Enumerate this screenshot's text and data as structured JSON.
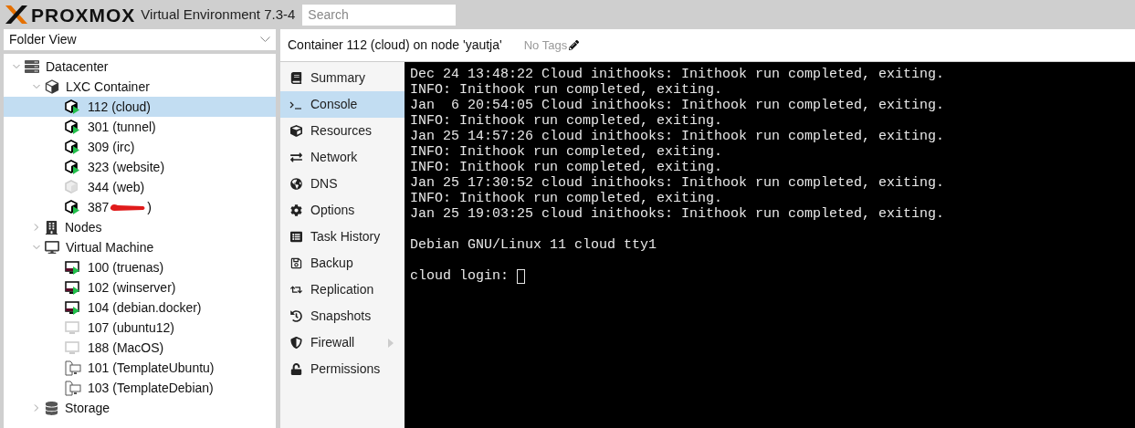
{
  "header": {
    "logo": "PROXMOX",
    "product": "Virtual Environment 7.3-4",
    "search": {
      "placeholder": "Search"
    }
  },
  "view_selector": {
    "value": "Folder View"
  },
  "tree": [
    {
      "kind": "datacenter",
      "label": "Datacenter",
      "expanded": true,
      "selected": false,
      "children": [
        {
          "kind": "folder-ct",
          "label": "LXC Container",
          "expanded": true,
          "selected": false,
          "children": [
            {
              "kind": "ct",
              "label": "112 (cloud)",
              "running": true,
              "selected": true
            },
            {
              "kind": "ct",
              "label": "301 (tunnel)",
              "running": true,
              "selected": false
            },
            {
              "kind": "ct",
              "label": "309 (irc)",
              "running": true,
              "selected": false
            },
            {
              "kind": "ct",
              "label": "323 (website)",
              "running": true,
              "selected": false
            },
            {
              "kind": "ct",
              "label": "344 (web)",
              "running": false,
              "selected": false
            },
            {
              "kind": "ct",
              "label": "387",
              "running": true,
              "selected": false,
              "redacted": true,
              "tail": ")"
            }
          ]
        },
        {
          "kind": "nodes",
          "label": "Nodes",
          "expanded": false,
          "selected": false
        },
        {
          "kind": "folder-vm",
          "label": "Virtual Machine",
          "expanded": true,
          "selected": false,
          "children": [
            {
              "kind": "vm",
              "label": "100 (truenas)",
              "running": true,
              "selected": false
            },
            {
              "kind": "vm",
              "label": "102 (winserver)",
              "running": true,
              "selected": false
            },
            {
              "kind": "vm",
              "label": "104 (debian.docker)",
              "running": true,
              "selected": false
            },
            {
              "kind": "vm",
              "label": "107 (ubuntu12)",
              "running": false,
              "selected": false
            },
            {
              "kind": "vm",
              "label": "188 (MacOS)",
              "running": false,
              "selected": false
            },
            {
              "kind": "template",
              "label": "101 (TemplateUbuntu)",
              "selected": false
            },
            {
              "kind": "template",
              "label": "103 (TemplateDebian)",
              "selected": false
            }
          ]
        },
        {
          "kind": "storage",
          "label": "Storage",
          "expanded": false,
          "selected": false
        }
      ]
    }
  ],
  "content_header": {
    "title": "Container 112 (cloud) on node 'yautja'",
    "tags": "No Tags"
  },
  "menu": [
    {
      "kind": "summary",
      "label": "Summary",
      "selected": false
    },
    {
      "kind": "console",
      "label": "Console",
      "selected": true
    },
    {
      "kind": "resources",
      "label": "Resources",
      "selected": false
    },
    {
      "kind": "network",
      "label": "Network",
      "selected": false
    },
    {
      "kind": "dns",
      "label": "DNS",
      "selected": false
    },
    {
      "kind": "options",
      "label": "Options",
      "selected": false
    },
    {
      "kind": "tasks",
      "label": "Task History",
      "selected": false
    },
    {
      "kind": "backup",
      "label": "Backup",
      "selected": false
    },
    {
      "kind": "replication",
      "label": "Replication",
      "selected": false
    },
    {
      "kind": "snapshots",
      "label": "Snapshots",
      "selected": false
    },
    {
      "kind": "firewall",
      "label": "Firewall",
      "selected": false,
      "submenu": true
    },
    {
      "kind": "permissions",
      "label": "Permissions",
      "selected": false
    }
  ],
  "console": {
    "blocks": [
      [
        "Dec 24 13:48:22 Cloud inithooks: Inithook run completed, exiting.",
        "INFO: Inithook run completed, exiting.",
        "Jan  6 20:54:05 Cloud inithooks: Inithook run completed, exiting.",
        "INFO: Inithook run completed, exiting.",
        "Jan 25 14:57:26 cloud inithooks: Inithook run completed, exiting.",
        "INFO: Inithook run completed, exiting.",
        "INFO: Inithook run completed, exiting.",
        "Jan 25 17:30:52 cloud inithooks: Inithook run completed, exiting.",
        "INFO: Inithook run completed, exiting.",
        "Jan 25 19:03:25 cloud inithooks: Inithook run completed, exiting."
      ],
      [
        "Debian GNU/Linux 11 cloud tty1"
      ],
      [
        "cloud login: "
      ]
    ],
    "cursor": true
  }
}
